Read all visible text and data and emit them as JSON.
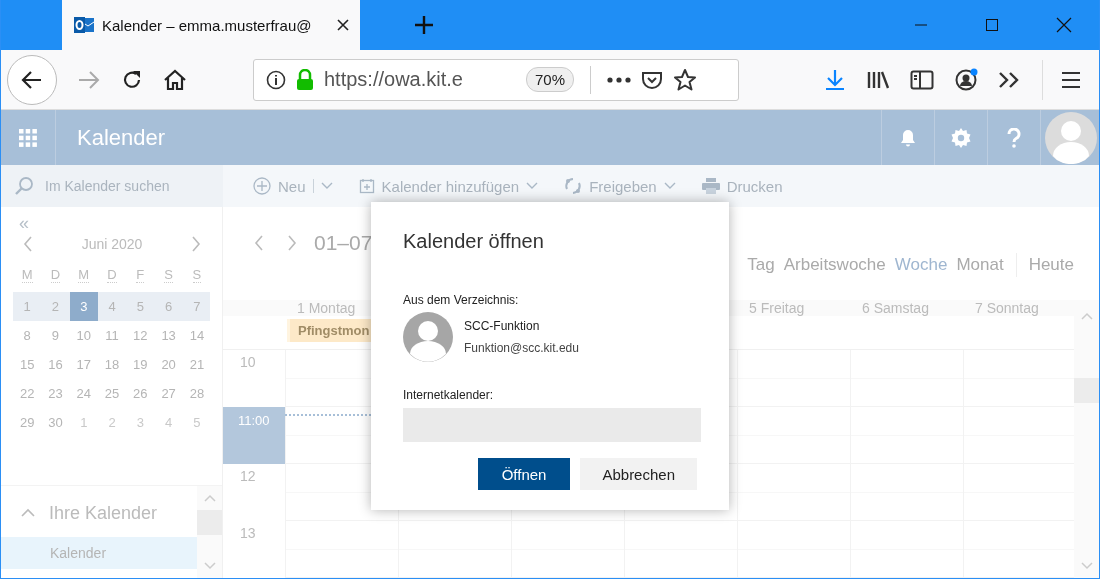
{
  "browser": {
    "tab": {
      "title": "Kalender – emma.musterfrau@",
      "selected": true
    },
    "url": "https://owa.kit.e",
    "zoom": "70%"
  },
  "app": {
    "title": "Kalender"
  },
  "search": {
    "placeholder": "Im Kalender suchen"
  },
  "toolbar": [
    {
      "label": "Neu",
      "kind": "split"
    },
    {
      "label": "Kalender hinzufügen",
      "kind": "dropdown"
    },
    {
      "label": "Freigeben",
      "kind": "dropdown"
    },
    {
      "label": "Drucken",
      "kind": "button"
    }
  ],
  "mini_calendar": {
    "collapse": "«",
    "month": "Juni 2020",
    "weekdays": [
      "M",
      "D",
      "M",
      "D",
      "F",
      "S",
      "S"
    ],
    "weeks": [
      {
        "highlighted": true,
        "days": [
          {
            "day": "1",
            "selected": false,
            "other_month": false
          },
          {
            "day": "2",
            "selected": false,
            "other_month": false
          },
          {
            "day": "3",
            "selected": true,
            "other_month": false
          },
          {
            "day": "4",
            "selected": false,
            "other_month": false
          },
          {
            "day": "5",
            "selected": false,
            "other_month": false
          },
          {
            "day": "6",
            "selected": false,
            "other_month": false
          },
          {
            "day": "7",
            "selected": false,
            "other_month": false
          }
        ]
      },
      {
        "highlighted": false,
        "days": [
          {
            "day": "8",
            "selected": false,
            "other_month": false
          },
          {
            "day": "9",
            "selected": false,
            "other_month": false
          },
          {
            "day": "10",
            "selected": false,
            "other_month": false
          },
          {
            "day": "11",
            "selected": false,
            "other_month": false
          },
          {
            "day": "12",
            "selected": false,
            "other_month": false
          },
          {
            "day": "13",
            "selected": false,
            "other_month": false
          },
          {
            "day": "14",
            "selected": false,
            "other_month": false
          }
        ]
      },
      {
        "highlighted": false,
        "days": [
          {
            "day": "15",
            "selected": false,
            "other_month": false
          },
          {
            "day": "16",
            "selected": false,
            "other_month": false
          },
          {
            "day": "17",
            "selected": false,
            "other_month": false
          },
          {
            "day": "18",
            "selected": false,
            "other_month": false
          },
          {
            "day": "19",
            "selected": false,
            "other_month": false
          },
          {
            "day": "20",
            "selected": false,
            "other_month": false
          },
          {
            "day": "21",
            "selected": false,
            "other_month": false
          }
        ]
      },
      {
        "highlighted": false,
        "days": [
          {
            "day": "22",
            "selected": false,
            "other_month": false
          },
          {
            "day": "23",
            "selected": false,
            "other_month": false
          },
          {
            "day": "24",
            "selected": false,
            "other_month": false
          },
          {
            "day": "25",
            "selected": false,
            "other_month": false
          },
          {
            "day": "26",
            "selected": false,
            "other_month": false
          },
          {
            "day": "27",
            "selected": false,
            "other_month": false
          },
          {
            "day": "28",
            "selected": false,
            "other_month": false
          }
        ]
      },
      {
        "highlighted": false,
        "days": [
          {
            "day": "29",
            "selected": false,
            "other_month": false
          },
          {
            "day": "30",
            "selected": false,
            "other_month": false
          },
          {
            "day": "1",
            "selected": false,
            "other_month": true
          },
          {
            "day": "2",
            "selected": false,
            "other_month": true
          },
          {
            "day": "3",
            "selected": false,
            "other_month": true
          },
          {
            "day": "4",
            "selected": false,
            "other_month": true
          },
          {
            "day": "5",
            "selected": false,
            "other_month": true
          }
        ]
      }
    ]
  },
  "calendars": {
    "heading": "Ihre Kalender",
    "expanded": true,
    "items": [
      {
        "label": "Kalender",
        "selected": true
      }
    ]
  },
  "week_view": {
    "range": "01–07",
    "views": [
      {
        "label": "Tag",
        "selected": false
      },
      {
        "label": "Arbeitswoche",
        "selected": false
      },
      {
        "label": "Woche",
        "selected": true
      },
      {
        "label": "Monat",
        "selected": false
      }
    ],
    "today": "Heute",
    "days": [
      {
        "label": "1 Montag"
      },
      {
        "label": "5 Freitag"
      },
      {
        "label": "6 Samstag"
      },
      {
        "label": "7 Sonntag"
      }
    ],
    "all_day_events": [
      {
        "title": "Pfingstmon"
      }
    ],
    "hours": [
      {
        "label": "10",
        "current": false
      },
      {
        "label": "11:00",
        "current": true
      },
      {
        "label": "12",
        "current": false
      },
      {
        "label": "13",
        "current": false
      }
    ]
  },
  "dialog": {
    "title": "Kalender öffnen",
    "directory_label": "Aus dem Verzeichnis:",
    "contact": {
      "name": "SCC-Funktion",
      "email": "Funktion@scc.kit.edu"
    },
    "internet_label": "Internetkalender:",
    "buttons": [
      {
        "label": "Öffnen",
        "primary": true
      },
      {
        "label": "Abbrechen",
        "primary": false
      }
    ]
  }
}
